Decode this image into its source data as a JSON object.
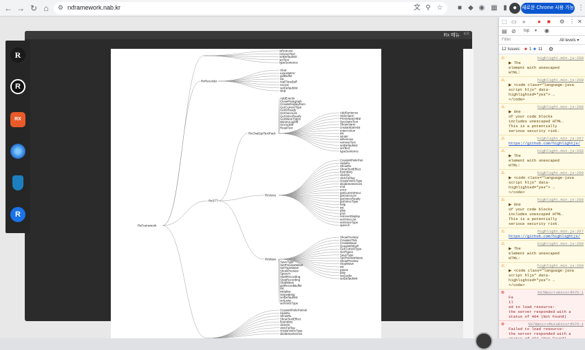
{
  "browser": {
    "url": "rxframework.nab.kr",
    "update_button": "새로운 Chrome 사용 가능"
  },
  "app": {
    "menu_label": "Rx 메뉴",
    "lang": "KR"
  },
  "sidebar_icons": [
    "rx-logo-icon",
    "r-circle-icon",
    "rx-badge-icon",
    "dial-icon",
    "shield-icon",
    "r-blue-icon"
  ],
  "tree": {
    "root": "RxFramework",
    "nodes": {
      "rxRecorder": "RxRecorder",
      "rxStt": "RxSTT",
      "rxChatGpt": "RxChatGptTextPack",
      "rxVoice": "RxVoice",
      "rxWave": "RxWave"
    },
    "top_leaves": [
      "isRemove",
      "removeText",
      "setDefaultInit",
      "setText",
      "typeSentence"
    ],
    "recorder_leaves": [
      "clear",
      "exportWAV",
      "getBuffer",
      "init",
      "realTimeBuff",
      "record",
      "setDefaultInit",
      "stop"
    ],
    "chatgpt_leaves_left": [
      "AddEvents",
      "CloseParagraph",
      "CreateDisplayDom",
      "GetCurrentType",
      "GetIsReady",
      "GetVoiceList",
      "GetVoiceReady",
      "GetWaveTypes",
      "MicOnAndOff",
      "OnAndOff",
      "ReadText"
    ],
    "chatgpt_leaves_right": [
      "AddSentence",
      "HideAlarm",
      "PressSpaceBar",
      "SetAlarmText",
      "ShowAlarm",
      "createStartHint",
      "enterAction",
      "init",
      "isInter",
      "isRemove",
      "removeText",
      "setDefaultInit",
      "setText",
      "typeSentence"
    ],
    "voice_leaves": [
      "CreateWholePan",
      "HideRx",
      "ShowRx",
      "ShowTextEffect",
      "boundary",
      "clickOn",
      "clickToPlay",
      "createVoiceType",
      "divideSentences",
      "end",
      "error",
      "getCurrentHour",
      "getVoiceList",
      "getVoiceReady",
      "getVoiceType",
      "help",
      "init",
      "play",
      "proc",
      "removeDisplay",
      "setVoiceList",
      "setVoiceType",
      "speech"
    ],
    "wave_leaves_right": [
      "ShowPreview",
      "CreateHTML",
      "CreateWave",
      "DrawWithBuff",
      "GetCurrentType",
      "GetTypes",
      "SaveType",
      "SetPreviewWave",
      "ShowPreview",
      "StopWave",
      "init",
      "pause",
      "play",
      "setAudio",
      "setDefaultInit"
    ],
    "wave_leaves_left": [
      "SaveType",
      "SetPreviewWave",
      "SetTypeWave",
      "ShowPreview",
      "Speech",
      "StartRecording",
      "StopRecording",
      "StopWave",
      "getRecordBuffer",
      "init",
      "initialize",
      "isSpeaking",
      "setDefaultInit",
      "setLang",
      "setVoiceType"
    ],
    "bottom_leaves": [
      "CreateWholePannel",
      "HideRx",
      "ShowRx",
      "ShowTextEffect",
      "boundary",
      "clickOn",
      "clickToPlay",
      "createVoiceType",
      "divideSentences"
    ]
  },
  "devtools": {
    "context": "top",
    "filter_placeholder": "Filter",
    "levels": "All levels ▾",
    "issues_label": "12 Issues:",
    "issues_err": "1",
    "issues_info": "11",
    "messages": [
      {
        "kind": "warn",
        "loc": "highlight.min.js:268",
        "lines": [
          "▶ The",
          "element with unescaped",
          "HTML:"
        ]
      },
      {
        "kind": "warn",
        "loc": "highlight.min.js:269",
        "lines": [
          "▶ <code class=\"language-java",
          "script hljs\" data-",
          "highlighted=\"yes\"> …",
          "</code>"
        ]
      },
      {
        "kind": "warn",
        "loc": "highlight.min.js:266",
        "lines": [
          "▶ One",
          "of your code blocks",
          "includes unescaped HTML.",
          "This is a potentially",
          "serious security risk."
        ]
      },
      {
        "kind": "warn",
        "loc": "highlight.min.js:267",
        "lines": [
          "https://github.com/highlightjs/"
        ]
      },
      {
        "kind": "warn",
        "loc": "highlight.min.js:268",
        "lines": [
          "▶ The",
          "element with unescaped",
          "HTML:"
        ]
      },
      {
        "kind": "warn",
        "loc": "highlight.min.js:269",
        "lines": [
          "▶ <code class=\"language-java",
          "script hljs\" data-",
          "highlighted=\"yes\"> …",
          "</code>"
        ]
      },
      {
        "kind": "warn",
        "loc": "highlight.min.js:266",
        "lines": [
          "▶ One",
          "of your code blocks",
          "includes unescaped HTML.",
          "This is a potentially",
          "serious security risk."
        ]
      },
      {
        "kind": "warn",
        "loc": "highlight.min.js:267",
        "lines": [
          "https://github.com/highlightjs/"
        ]
      },
      {
        "kind": "warn",
        "loc": "highlight.min.js:268",
        "lines": [
          "▶ The",
          "element with unescaped",
          "HTML:"
        ]
      },
      {
        "kind": "warn",
        "loc": "highlight.min.js:269",
        "lines": [
          "▶ <code class=\"language-java",
          "script hljs\" data-",
          "highlighted=\"yes\"> …",
          "</code>"
        ]
      },
      {
        "kind": "err",
        "loc": "%%7BmicroEncord%7D:1",
        "lines": [
          "Fa",
          "il",
          "ed to load resource:",
          "the server responded with a",
          "status of 404 (Not Found)"
        ]
      },
      {
        "kind": "err",
        "loc": "%%7BmicroMuteEncord%7D:1",
        "lines": [
          "Failed to load resource:",
          "the server responded with a",
          "status of 404 (Not Found)"
        ]
      }
    ]
  },
  "colors": {
    "warn_bg": "#fffbe5",
    "err_bg": "#fff0f0",
    "accent": "#0b57d0"
  }
}
